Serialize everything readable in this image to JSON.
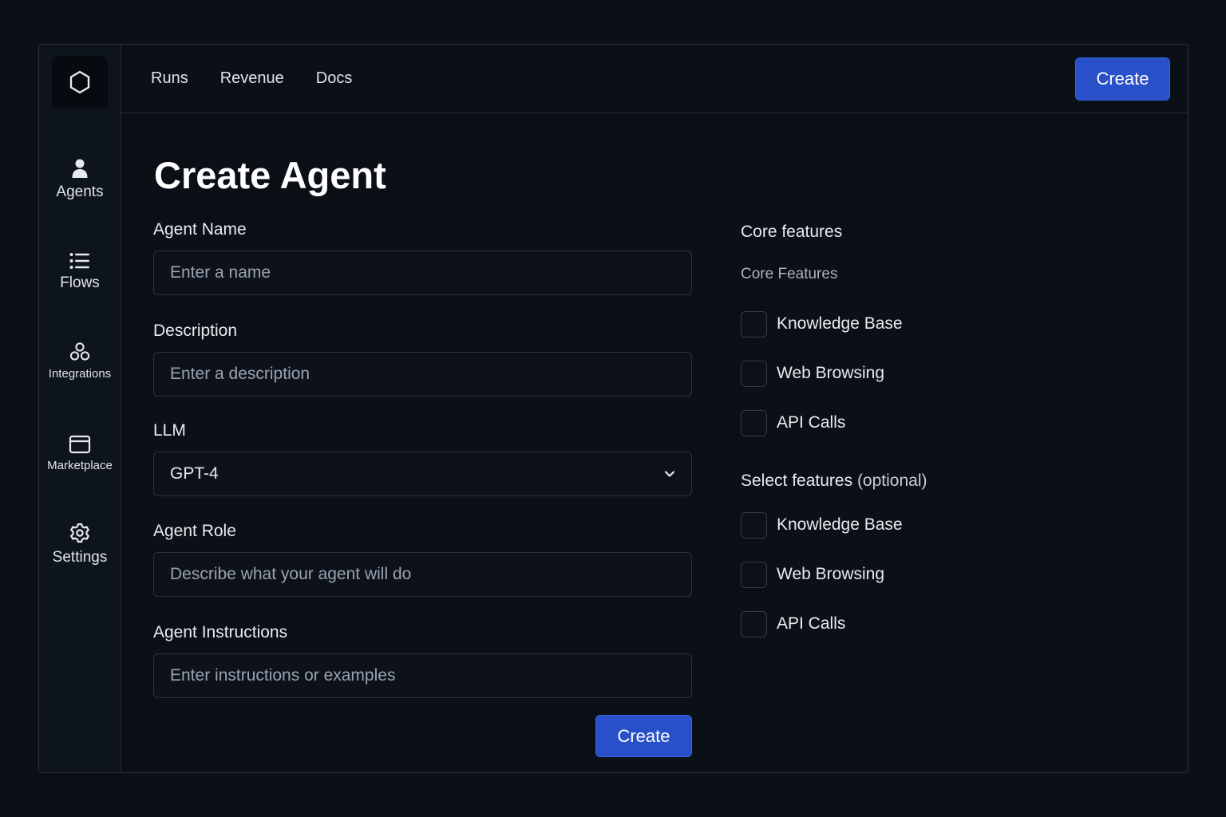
{
  "sidebar": {
    "logo_icon": "hexagon-icon",
    "items": [
      {
        "label": "Agents",
        "icon": "person-icon"
      },
      {
        "label": "Flows",
        "icon": "list-icon"
      },
      {
        "label": "Integrations",
        "icon": "integrations-icon"
      },
      {
        "label": "Marketplace",
        "icon": "window-icon"
      },
      {
        "label": "Settings",
        "icon": "gear-icon"
      }
    ]
  },
  "topbar": {
    "nav": [
      "Runs",
      "Revenue",
      "Docs"
    ],
    "create_label": "Create"
  },
  "page": {
    "title": "Create Agent"
  },
  "form": {
    "agent_name": {
      "label": "Agent Name",
      "placeholder": "Enter a name"
    },
    "description": {
      "label": "Description",
      "placeholder": "Enter a description"
    },
    "llm": {
      "label": "LLM",
      "value": "GPT-4"
    },
    "agent_role": {
      "label": "Agent Role",
      "placeholder": "Describe what your agent will do"
    },
    "agent_instructions": {
      "label": "Agent Instructions",
      "placeholder": "Enter instructions or examples"
    },
    "create_label": "Create"
  },
  "features": {
    "core_title": "Core features",
    "core_subtitle": "Core Features",
    "core_items": [
      "Knowledge Base",
      "Web Browsing",
      "API Calls"
    ],
    "select_title": "Select features",
    "select_optional": "(optional)",
    "select_items": [
      "Knowledge Base",
      "Web Browsing",
      "API Calls"
    ]
  },
  "colors": {
    "accent": "#2850c8",
    "background": "#0b0f16",
    "sidebar": "#0e141d"
  }
}
